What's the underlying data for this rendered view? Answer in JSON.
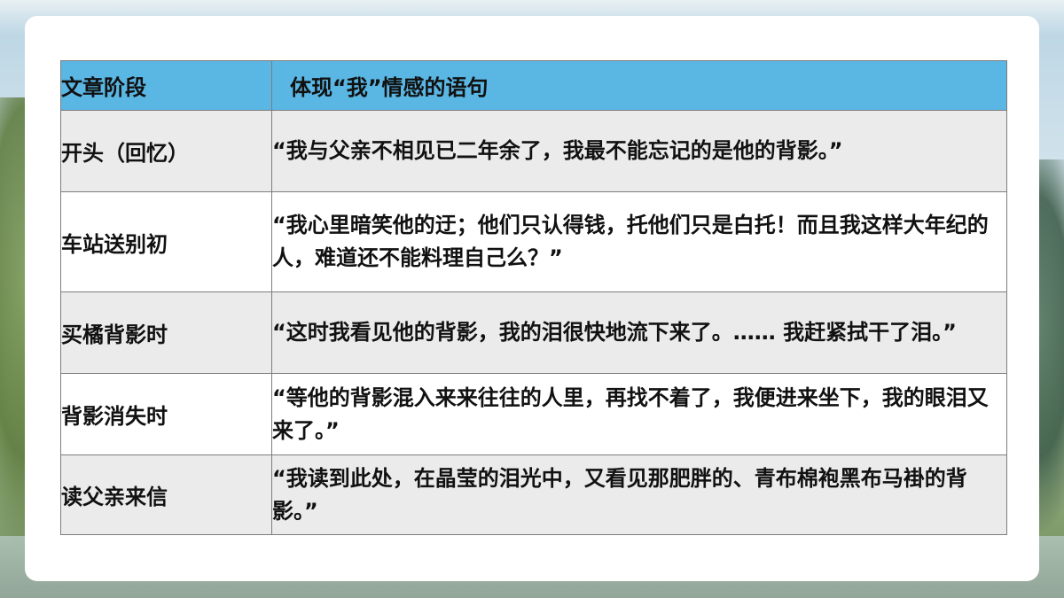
{
  "table": {
    "headers": [
      "文章阶段",
      "体现“我”情感的语句"
    ],
    "rows": [
      {
        "stage": "开头（回忆）",
        "quote": " “我与父亲不相见已二年余了，我最不能忘记的是他的背影。”"
      },
      {
        "stage": "车站送别初",
        "quote": "  “我心里暗笑他的迂；他们只认得钱，托他们只是白托！而且我这样大年纪的人，难道还不能料理自己么？”"
      },
      {
        "stage": "买橘背影时",
        "quote": "  “这时我看见他的背影，我的泪很快地流下来了。…… 我赶紧拭干了泪。”"
      },
      {
        "stage": "背影消失时",
        "quote": " “等他的背影混入来来往往的人里，再找不着了，我便进来坐下，我的眼泪又来了。”"
      },
      {
        "stage": "读父亲来信",
        "quote": " “我读到此处，在晶莹的泪光中，又看见那肥胖的、青布棉袍黑布马褂的背影。”"
      }
    ]
  },
  "colors": {
    "header_bg": "#5ab6e3",
    "row_gray": "#ebebeb",
    "row_white": "#ffffff",
    "border": "#7d7d7d"
  }
}
